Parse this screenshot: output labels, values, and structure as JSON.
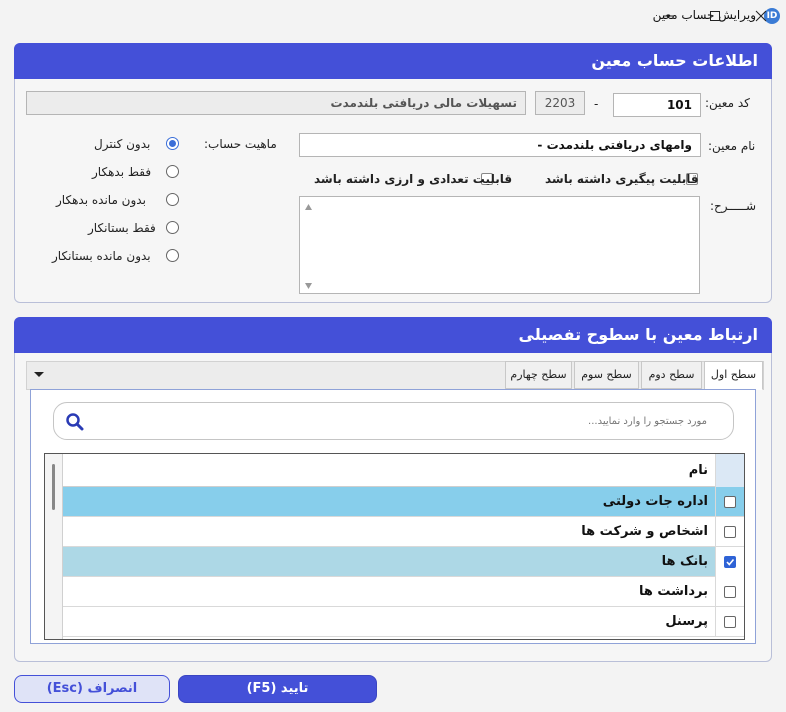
{
  "window": {
    "title": "ویرایش حساب معین",
    "icon": "app-logo-icon"
  },
  "info_panel": {
    "header": "اطلاعات حساب معین",
    "code_label": "کد معین:",
    "code_value": "101",
    "code_separator": "-",
    "parent_code": "2203",
    "parent_name": "تسهیلات مالی دریافتی بلندمدت",
    "name_label": "نام معین:",
    "name_value": "وامهای دریافتی بلندمدت -",
    "nature_label": "ماهیت حساب:",
    "nature_options": [
      {
        "label": "بدون کنترل",
        "selected": true
      },
      {
        "label": "فقط بدهکار",
        "selected": false
      },
      {
        "label": "بدون مانده بدهکار",
        "selected": false
      },
      {
        "label": "فقط بستانکار",
        "selected": false
      },
      {
        "label": "بدون مانده بستانکار",
        "selected": false
      }
    ],
    "followup_label": "قابلیت پیگیری داشته باشد",
    "followup_checked": false,
    "quantity_currency_label": "قابلیت تعدادی و ارزی داشته باشد",
    "quantity_currency_checked": false,
    "description_label": "شـــــرح:",
    "description_value": ""
  },
  "relations_panel": {
    "header": "ارتباط معین با سطوح تفصیلی",
    "tabs": [
      {
        "label": "سطح اول",
        "active": true
      },
      {
        "label": "سطح دوم",
        "active": false
      },
      {
        "label": "سطح سوم",
        "active": false
      },
      {
        "label": "سطح چهارم",
        "active": false
      }
    ],
    "search_placeholder": "مورد جستجو را وارد نمایید...",
    "column_name": "نام",
    "rows": [
      {
        "name": "اداره جات دولتی",
        "checked": false,
        "highlight": "selected"
      },
      {
        "name": "اشخاص و شرکت ها",
        "checked": false,
        "highlight": "none"
      },
      {
        "name": "بانک ها",
        "checked": true,
        "highlight": "checked"
      },
      {
        "name": "برداشت ها",
        "checked": false,
        "highlight": "none"
      },
      {
        "name": "پرسنل",
        "checked": false,
        "highlight": "none"
      }
    ]
  },
  "buttons": {
    "confirm": "تایید (F5)",
    "cancel": "انصراف (Esc)"
  },
  "colors": {
    "accent": "#4450d8",
    "row_selected": "#87ceeb",
    "row_checked": "#add8e6",
    "checkbox_checked": "#2f63d6"
  }
}
